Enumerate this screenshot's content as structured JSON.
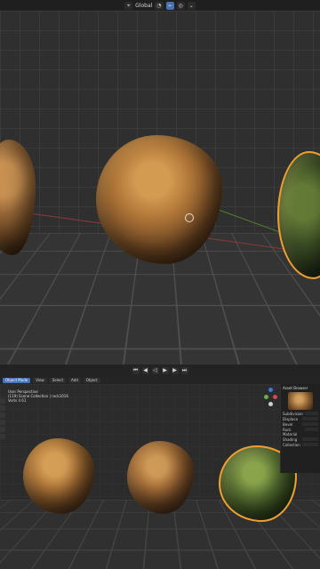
{
  "top_toolbar": {
    "transform_orientation": "Global",
    "items": [
      "global-transform",
      "pivot",
      "snap",
      "proportional-edit",
      "overlay"
    ]
  },
  "playback": {
    "buttons": [
      "jump-start",
      "prev-keyframe",
      "play-reverse",
      "play",
      "next-keyframe",
      "jump-end"
    ]
  },
  "lower_editor": {
    "header_items": [
      "Object Mode",
      "View",
      "Select",
      "Add",
      "Object"
    ],
    "info_lines": [
      "User Perspective",
      "(119) Scene Collection | rock1016",
      "Verts 4 61"
    ],
    "side_panel": {
      "title": "Asset Browser",
      "rows": [
        "Subdivision",
        "Displace",
        "Bevel",
        "Rock Material",
        "Shading",
        "Collection"
      ]
    }
  },
  "colors": {
    "selection": "#f0a030",
    "active": "#4772b3"
  }
}
